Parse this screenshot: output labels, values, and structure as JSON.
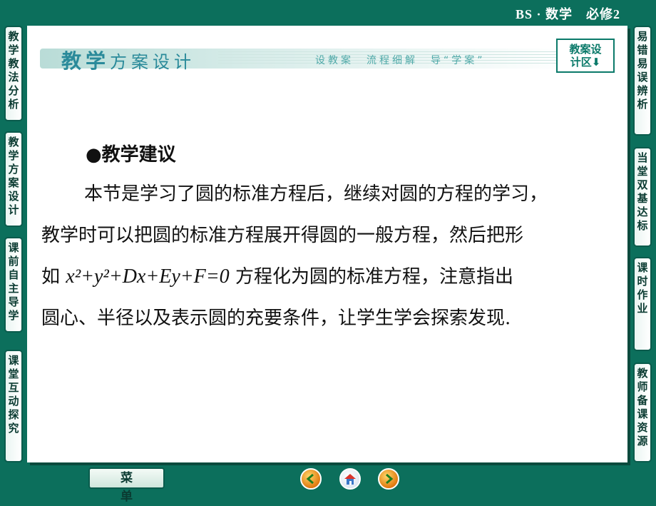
{
  "header": {
    "course_title": "BS · 数学　必修2"
  },
  "banner": {
    "title_big": "教学",
    "title_rest": "方案设计",
    "subtitle": "设教案　流程细解　导“学案”",
    "design_area_line1": "教案设",
    "design_area_line2": "计区⬇"
  },
  "content": {
    "section_heading": "●教学建议",
    "line1": "本节是学习了圆的标准方程后，继续对圆的方程的学习，",
    "line2": "教学时可以把圆的标准方程展开得圆的一般方程，然后把形",
    "line3_pre": "如",
    "line3_math": "x²+y²+Dx+Ey+F=0",
    "line3_post": "方程化为圆的标准方程，注意指出",
    "line4": "圆心、半径以及表示圆的充要条件，让学生学会探索发现."
  },
  "left_tabs": [
    "教学教法分析",
    "教学方案设计",
    "课前自主导学",
    "课堂互动探究"
  ],
  "right_tabs": [
    "易错易误辨析",
    "当堂双基达标",
    "课时作业",
    "教师备课资源"
  ],
  "footer": {
    "menu_label": "菜单",
    "nav_icons": [
      "back-icon",
      "home-icon",
      "forward-icon"
    ]
  },
  "colors": {
    "background": "#0c6f5c",
    "accent": "#2a8a9a",
    "tab_border": "#0a5b4c"
  }
}
